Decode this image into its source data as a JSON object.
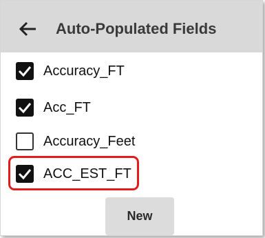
{
  "header": {
    "title": "Auto-Populated Fields",
    "back_icon": "arrow-left-icon"
  },
  "fields": [
    {
      "label": "Accuracy_FT",
      "checked": true
    },
    {
      "label": "Acc_FT",
      "checked": true
    },
    {
      "label": "Accuracy_Feet",
      "checked": false
    },
    {
      "label": "ACC_EST_FT",
      "checked": true,
      "highlighted": true
    }
  ],
  "actions": {
    "new_label": "New"
  },
  "colors": {
    "header_bg": "#d9d9d9",
    "highlight": "#e21b1b",
    "button_bg": "#dcdcdc"
  }
}
